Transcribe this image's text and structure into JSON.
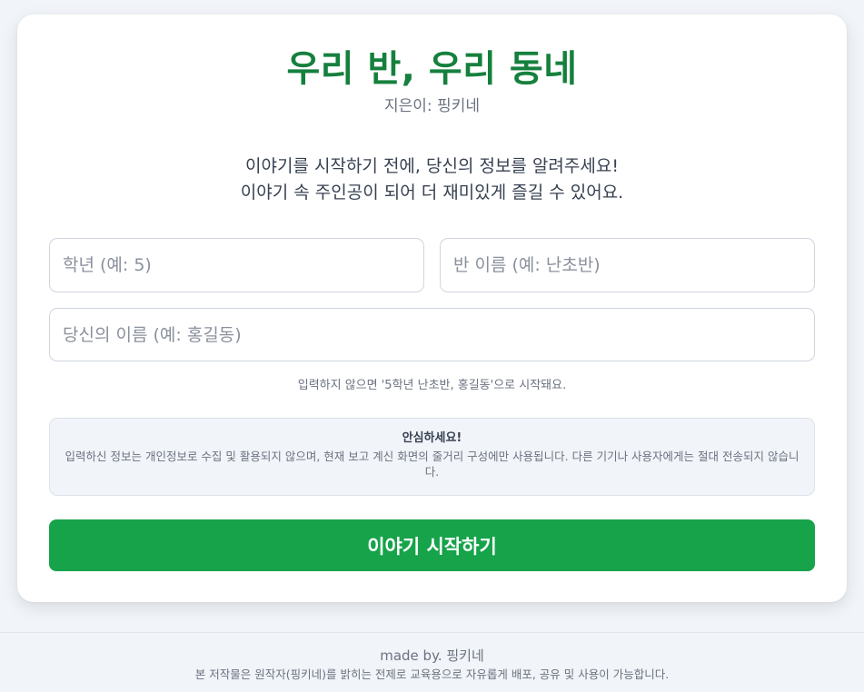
{
  "header": {
    "title": "우리 반, 우리 동네",
    "author": "지은이: 핑키네"
  },
  "intro": {
    "line1": "이야기를 시작하기 전에, 당신의 정보를 알려주세요!",
    "line2": "이야기 속 주인공이 되어 더 재미있게 즐길 수 있어요."
  },
  "form": {
    "grade": {
      "placeholder": "학년 (예: 5)",
      "value": ""
    },
    "class_name": {
      "placeholder": "반 이름 (예: 난초반)",
      "value": ""
    },
    "user_name": {
      "placeholder": "당신의 이름 (예: 홍길동)",
      "value": ""
    },
    "hint": "입력하지 않으면 '5학년 난초반, 홍길동'으로 시작돼요."
  },
  "notice": {
    "title": "안심하세요!",
    "body": "입력하신 정보는 개인정보로 수집 및 활용되지 않으며, 현재 보고 계신 화면의 줄거리 구성에만 사용됩니다. 다른 기기나 사용자에게는 절대 전송되지 않습니다."
  },
  "actions": {
    "start_label": "이야기 시작하기"
  },
  "footer": {
    "made_by": "made by. 핑키네",
    "copyright": "본 저작물은 원작자(핑키네)를 밝히는 전제로 교육용으로 자유롭게 배포, 공유 및 사용이 가능합니다."
  },
  "colors": {
    "accent": "#15803d",
    "button": "#16a34a",
    "background": "#f1f4f8"
  }
}
